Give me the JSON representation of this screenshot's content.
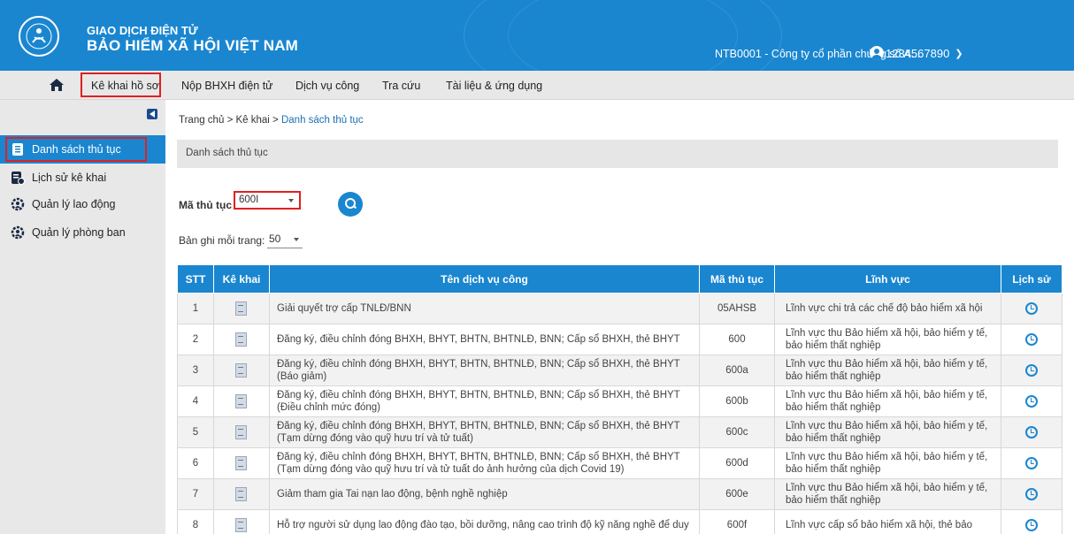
{
  "header": {
    "brand_line1": "GIAO DỊCH ĐIỆN TỬ",
    "brand_line2": "BẢO HIỂM XÃ HỘI VIỆT NAM",
    "company": "NTB0001 - Công ty cổ phần chứng số A...",
    "user": "1234567890",
    "color": "#1a86d0"
  },
  "menu": {
    "items": [
      "Kê khai hồ sơ",
      "Nộp BHXH điện tử",
      "Dịch vụ công",
      "Tra cứu",
      "Tài liệu & ứng dụng"
    ],
    "active": "Kê khai hồ sơ"
  },
  "sidebar": {
    "items": [
      {
        "label": "Danh sách thủ tục",
        "icon": "list-doc-icon",
        "active": true
      },
      {
        "label": "Lịch sử kê khai",
        "icon": "history-doc-icon",
        "active": false
      },
      {
        "label": "Quản lý lao động",
        "icon": "users-gear-icon",
        "active": false
      },
      {
        "label": "Quản lý phòng ban",
        "icon": "users-gear-icon",
        "active": false
      }
    ]
  },
  "breadcrumb": {
    "home": "Trang chủ",
    "sep": ">",
    "level1": "Kê khai",
    "current": "Danh sách thủ tục"
  },
  "page_title": "Danh sách thủ tục",
  "filter": {
    "label": "Mã thủ tục",
    "value": "600I"
  },
  "perpage": {
    "label": "Bản ghi mỗi trang:",
    "value": "50"
  },
  "table": {
    "headers": [
      "STT",
      "Kê khai",
      "Tên dịch vụ công",
      "Mã thủ tục",
      "Lĩnh vực",
      "Lịch sử"
    ],
    "rows": [
      {
        "stt": "1",
        "name": "Giải quyết trợ cấp TNLĐ/BNN",
        "code": "05AHSB",
        "field": "Lĩnh vực chi trả các chế độ bảo hiểm xã hội"
      },
      {
        "stt": "2",
        "name": "Đăng ký, điều chỉnh đóng BHXH, BHYT, BHTN, BHTNLĐ, BNN; Cấp sổ BHXH, thẻ BHYT",
        "code": "600",
        "field": "Lĩnh vực thu Bảo hiểm xã hội, bảo hiểm y tế, bảo hiểm thất nghiệp"
      },
      {
        "stt": "3",
        "name": "Đăng ký, điều chỉnh đóng BHXH, BHYT, BHTN, BHTNLĐ, BNN; Cấp sổ BHXH, thẻ BHYT (Báo giảm)",
        "code": "600a",
        "field": "Lĩnh vực thu Bảo hiểm xã hội, bảo hiểm y tế, bảo hiểm thất nghiệp"
      },
      {
        "stt": "4",
        "name": "Đăng ký, điều chỉnh đóng BHXH, BHYT, BHTN, BHTNLĐ, BNN; Cấp sổ BHXH, thẻ BHYT (Điều chỉnh mức đóng)",
        "code": "600b",
        "field": "Lĩnh vực thu Bảo hiểm xã hội, bảo hiểm y tế, bảo hiểm thất nghiệp"
      },
      {
        "stt": "5",
        "name": "Đăng ký, điều chỉnh đóng BHXH, BHYT, BHTN, BHTNLĐ, BNN; Cấp sổ BHXH, thẻ BHYT (Tạm dừng đóng vào quỹ hưu trí và tử tuất)",
        "code": "600c",
        "field": "Lĩnh vực thu Bảo hiểm xã hội, bảo hiểm y tế, bảo hiểm thất nghiệp"
      },
      {
        "stt": "6",
        "name": "Đăng ký, điều chỉnh đóng BHXH, BHYT, BHTN, BHTNLĐ, BNN; Cấp sổ BHXH, thẻ BHYT (Tạm dừng đóng vào quỹ hưu trí và tử tuất do ảnh hưởng của dịch Covid 19)",
        "code": "600d",
        "field": "Lĩnh vực thu Bảo hiểm xã hội, bảo hiểm y tế, bảo hiểm thất nghiệp"
      },
      {
        "stt": "7",
        "name": "Giảm tham gia Tai nạn lao động, bệnh nghề nghiệp",
        "code": "600e",
        "field": "Lĩnh vực thu Bảo hiểm xã hội, bảo hiểm y tế, bảo hiểm thất nghiệp"
      },
      {
        "stt": "8",
        "name": "Hỗ trợ người sử dụng lao động đào tạo, bồi dưỡng, nâng cao trình độ kỹ năng nghề để duy",
        "code": "600f",
        "field": "Lĩnh vực cấp sổ bảo hiểm xã hội, thẻ bảo"
      }
    ]
  }
}
